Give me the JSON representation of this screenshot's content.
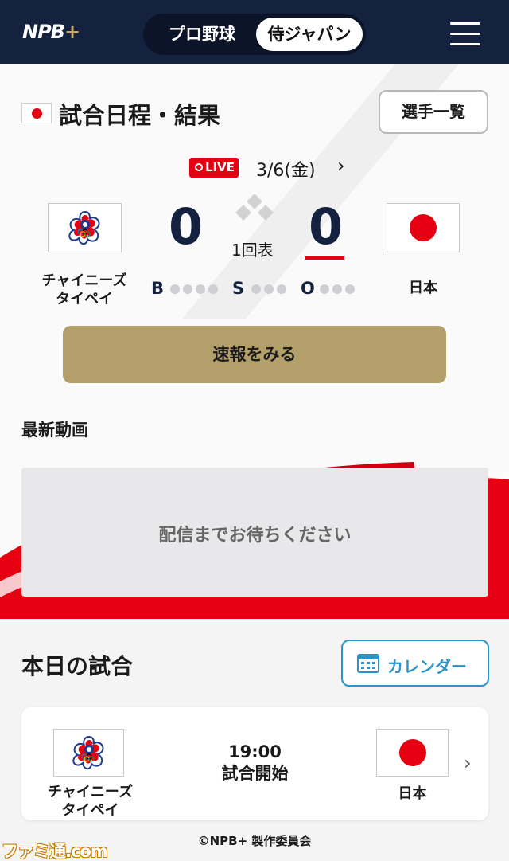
{
  "header": {
    "logo": "NPB",
    "logo_plus": "+",
    "tabs": [
      {
        "label": "プロ野球",
        "active": false
      },
      {
        "label": "侍ジャパン",
        "active": true
      }
    ]
  },
  "schedule": {
    "title": "試合日程・結果",
    "players_button": "選手一覧"
  },
  "live_game": {
    "live_label": "LIVE",
    "date": "3/6(金)",
    "next_icon": "chevron-right-icon",
    "away": {
      "name_line1": "チャイニーズ",
      "name_line2": "タイペイ",
      "score": "0"
    },
    "home": {
      "name": "日本",
      "score": "0"
    },
    "inning": "1回表",
    "count": {
      "b_label": "B",
      "s_label": "S",
      "o_label": "O"
    },
    "news_button": "速報をみる"
  },
  "video": {
    "title": "最新動画",
    "placeholder": "配信までお待ちください"
  },
  "today": {
    "title": "本日の試合",
    "calendar_button": "カレンダー",
    "game": {
      "away_line1": "チャイニーズ",
      "away_line2": "タイペイ",
      "home": "日本",
      "time": "19:00",
      "status": "試合開始"
    }
  },
  "footer": {
    "copyright": "©NPB+ 製作委員会",
    "watermark": "ファミ通.com"
  },
  "colors": {
    "navy": "#14223f",
    "red": "#e60012",
    "gold": "#b39f6a",
    "accent_blue": "#2b93c9"
  }
}
